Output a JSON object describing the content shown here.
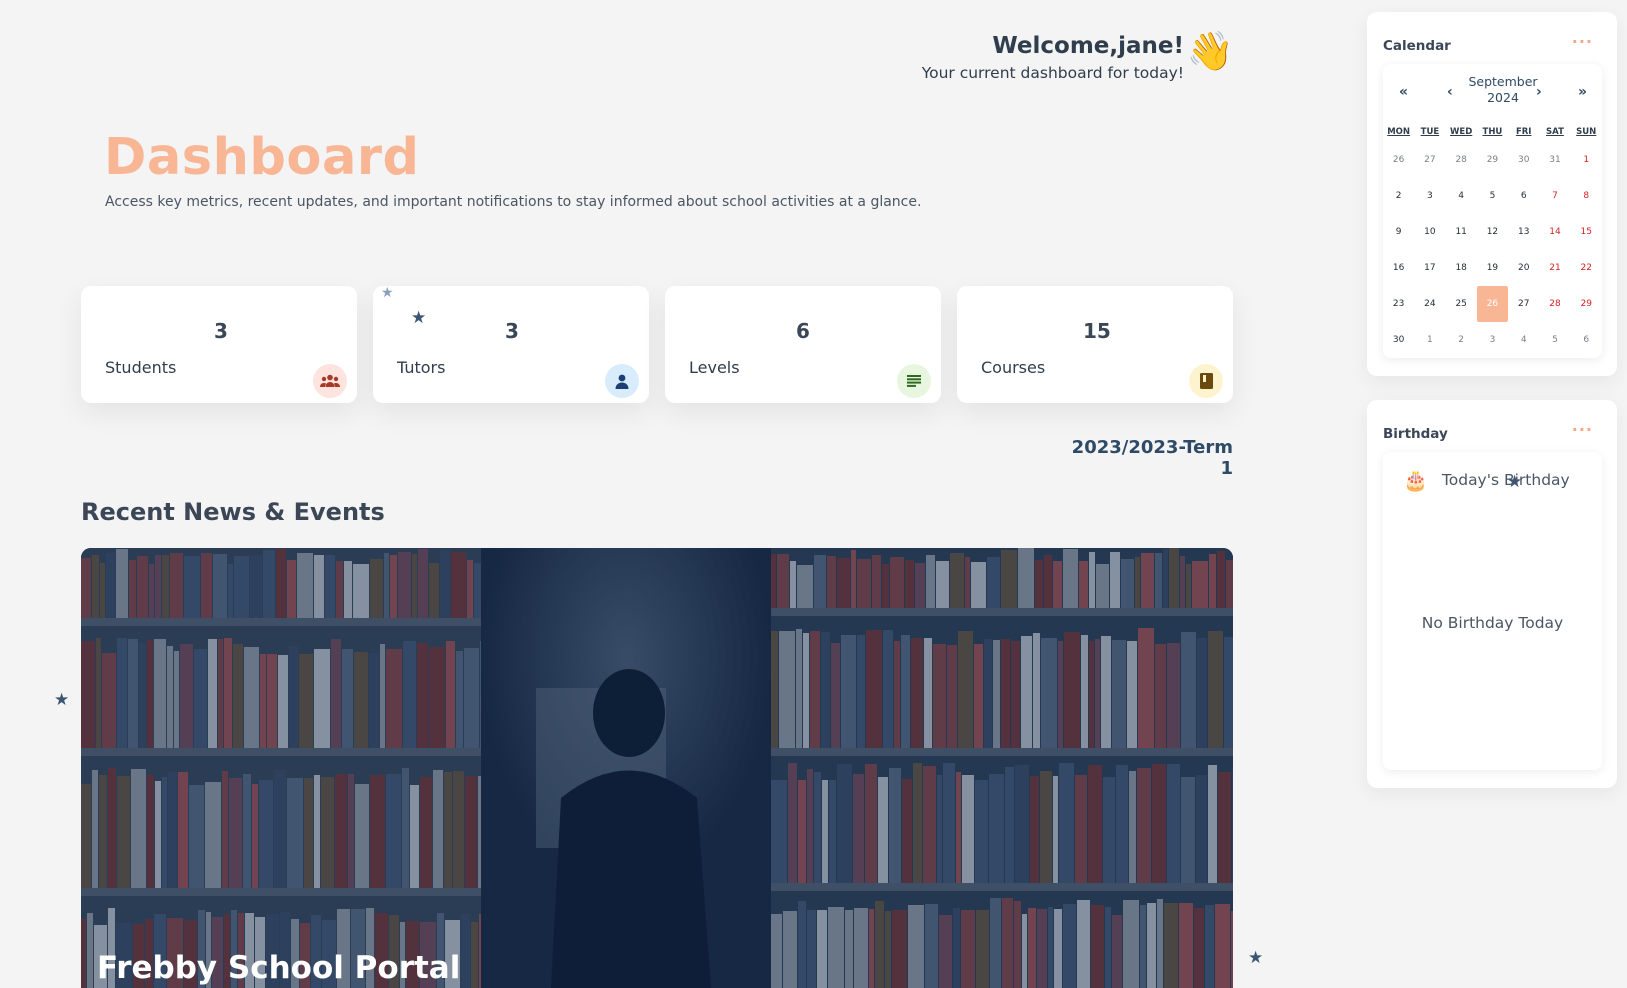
{
  "header": {
    "welcome": "Welcome,jane!",
    "subtitle": "Your current dashboard for today!",
    "wave_icon": "👋"
  },
  "page": {
    "title": "Dashboard",
    "description": "Access key metrics, recent updates, and important notifications to stay informed about school activities at a glance."
  },
  "stats": [
    {
      "value": "3",
      "label": "Students",
      "icon": "group-icon",
      "icon_bg": "#fde4de",
      "icon_color": "#a83a2a"
    },
    {
      "value": "3",
      "label": "Tutors",
      "icon": "person-icon",
      "icon_bg": "#d8ecfb",
      "icon_color": "#1d3f74"
    },
    {
      "value": "6",
      "label": "Levels",
      "icon": "list-icon",
      "icon_bg": "#e8f6df",
      "icon_color": "#2f6b1e"
    },
    {
      "value": "15",
      "label": "Courses",
      "icon": "book-icon",
      "icon_bg": "#fdf4cf",
      "icon_color": "#6b4a0e"
    }
  ],
  "term": "2023/2023-Term 1",
  "news": {
    "heading": "Recent News & Events",
    "caption": "Frebby School Portal"
  },
  "calendar": {
    "title": "Calendar",
    "menu": "···",
    "month": "September",
    "year": "2024",
    "nav_first": "«",
    "nav_prev": "‹",
    "nav_next": "›",
    "nav_last": "»",
    "weekdays": [
      "MON",
      "TUE",
      "WED",
      "THU",
      "FRI",
      "SAT",
      "SUN"
    ],
    "weeks": [
      [
        "26",
        "27",
        "28",
        "29",
        "30",
        "31",
        "1"
      ],
      [
        "2",
        "3",
        "4",
        "5",
        "6",
        "7",
        "8"
      ],
      [
        "9",
        "10",
        "11",
        "12",
        "13",
        "14",
        "15"
      ],
      [
        "16",
        "17",
        "18",
        "19",
        "20",
        "21",
        "22"
      ],
      [
        "23",
        "24",
        "25",
        "26",
        "27",
        "28",
        "29"
      ],
      [
        "30",
        "1",
        "2",
        "3",
        "4",
        "5",
        "6"
      ]
    ],
    "today": "26",
    "accent": "#f9b695",
    "weekend_color": "#d62020"
  },
  "birthday": {
    "title": "Birthday",
    "menu": "···",
    "cake_icon": "🎂",
    "today_label": "Today's Birthday",
    "empty": "No Birthday Today"
  },
  "colors": {
    "accent": "#f9b695",
    "text": "#2f3d4d",
    "background": "#f4f4f4"
  }
}
